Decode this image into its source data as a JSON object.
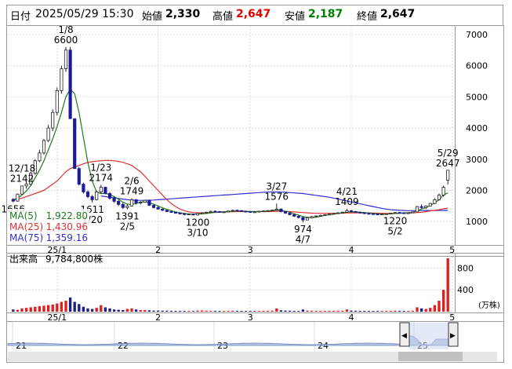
{
  "header": {
    "date_label": "日付",
    "datetime": "2025/05/29 15:30",
    "open_label": "始値",
    "open_value": "2,330",
    "high_label": "高値",
    "high_value": "2,647",
    "low_label": "安値",
    "low_value": "2,187",
    "close_label": "終値",
    "close_value": "2,647"
  },
  "colors": {
    "up": "#ffffff",
    "down": "#1a1aa0",
    "ma5": "#1e7a1e",
    "ma25": "#e03030",
    "ma75": "#3030d0",
    "high_value": "#e00000",
    "low_value": "#008000",
    "volume_up": "#e02020",
    "volume_down": "#202080",
    "minimap": "#8aa0d0"
  },
  "legend": [
    {
      "name": "MA(5)",
      "value": "1,922.80",
      "color": "#1e7a1e"
    },
    {
      "name": "MA(25)",
      "value": "1,430.96",
      "color": "#e03030"
    },
    {
      "name": "MA(75)",
      "value": "1,359.16",
      "color": "#3030d0"
    }
  ],
  "volume_panel": {
    "label": "出来高",
    "value": "9,784,800株",
    "unit": "(万株)"
  },
  "minimap": {
    "year_labels": [
      "21",
      "22",
      "23",
      "24",
      "25"
    ],
    "left_handle": "◀",
    "right_handle": "▶"
  },
  "chart_data": {
    "type": "candlestick",
    "y_ticks": [
      1000,
      2000,
      3000,
      4000,
      5000,
      6000,
      7000
    ],
    "ylim": [
      300,
      7200
    ],
    "x_tick_labels": [
      "25/1",
      "2",
      "3",
      "4",
      "5"
    ],
    "x_tick_index": [
      10,
      33,
      54,
      77,
      100
    ],
    "candles": [
      [
        1710,
        1750,
        1620,
        1656
      ],
      [
        1656,
        1900,
        1640,
        1880
      ],
      [
        1880,
        2150,
        1860,
        2142
      ],
      [
        2142,
        2300,
        2050,
        2200
      ],
      [
        2200,
        2600,
        2150,
        2550
      ],
      [
        2550,
        3000,
        2500,
        2950
      ],
      [
        2950,
        3300,
        2900,
        3200
      ],
      [
        3200,
        3650,
        3150,
        3600
      ],
      [
        3600,
        4100,
        3550,
        4000
      ],
      [
        4000,
        4600,
        3900,
        4500
      ],
      [
        4500,
        5300,
        4400,
        5200
      ],
      [
        5200,
        6000,
        5100,
        5900
      ],
      [
        5900,
        6600,
        5800,
        6500
      ],
      [
        6500,
        6600,
        4300,
        4300
      ],
      [
        4300,
        4300,
        2700,
        2700
      ],
      [
        2700,
        2750,
        2150,
        2200
      ],
      [
        2200,
        2250,
        1900,
        1950
      ],
      [
        1950,
        2000,
        1750,
        1800
      ],
      [
        1800,
        1850,
        1611,
        1700
      ],
      [
        1700,
        2000,
        1680,
        1950
      ],
      [
        1950,
        2174,
        1900,
        2100
      ],
      [
        2100,
        2120,
        1880,
        1900
      ],
      [
        1900,
        1950,
        1700,
        1750
      ],
      [
        1750,
        1800,
        1600,
        1650
      ],
      [
        1650,
        1700,
        1500,
        1550
      ],
      [
        1550,
        1600,
        1400,
        1450
      ],
      [
        1450,
        1550,
        1391,
        1500
      ],
      [
        1500,
        1749,
        1480,
        1700
      ],
      [
        1700,
        1720,
        1550,
        1600
      ],
      [
        1600,
        1650,
        1550,
        1620
      ],
      [
        1620,
        1700,
        1600,
        1680
      ],
      [
        1680,
        1700,
        1500,
        1520
      ],
      [
        1520,
        1550,
        1420,
        1450
      ],
      [
        1450,
        1500,
        1380,
        1400
      ],
      [
        1400,
        1420,
        1340,
        1360
      ],
      [
        1360,
        1380,
        1300,
        1320
      ],
      [
        1320,
        1350,
        1280,
        1300
      ],
      [
        1300,
        1320,
        1250,
        1270
      ],
      [
        1270,
        1300,
        1230,
        1250
      ],
      [
        1250,
        1280,
        1200,
        1230
      ],
      [
        1230,
        1260,
        1210,
        1240
      ],
      [
        1240,
        1250,
        1200,
        1210
      ],
      [
        1210,
        1280,
        1200,
        1260
      ],
      [
        1260,
        1300,
        1240,
        1280
      ],
      [
        1280,
        1320,
        1260,
        1300
      ],
      [
        1300,
        1350,
        1280,
        1330
      ],
      [
        1330,
        1360,
        1300,
        1320
      ],
      [
        1320,
        1340,
        1290,
        1300
      ],
      [
        1300,
        1330,
        1280,
        1310
      ],
      [
        1310,
        1350,
        1300,
        1340
      ],
      [
        1340,
        1380,
        1320,
        1360
      ],
      [
        1360,
        1390,
        1340,
        1350
      ],
      [
        1350,
        1370,
        1320,
        1330
      ],
      [
        1330,
        1350,
        1310,
        1320
      ],
      [
        1320,
        1340,
        1290,
        1300
      ],
      [
        1300,
        1330,
        1280,
        1310
      ],
      [
        1310,
        1340,
        1300,
        1330
      ],
      [
        1330,
        1360,
        1310,
        1340
      ],
      [
        1340,
        1370,
        1320,
        1350
      ],
      [
        1350,
        1380,
        1330,
        1370
      ],
      [
        1370,
        1576,
        1360,
        1400
      ],
      [
        1400,
        1420,
        1300,
        1320
      ],
      [
        1320,
        1340,
        1250,
        1270
      ],
      [
        1270,
        1290,
        1200,
        1220
      ],
      [
        1220,
        1250,
        1150,
        1170
      ],
      [
        1170,
        1200,
        1100,
        1130
      ],
      [
        1130,
        1150,
        974,
        1050
      ],
      [
        1050,
        1150,
        1040,
        1120
      ],
      [
        1120,
        1180,
        1100,
        1160
      ],
      [
        1160,
        1200,
        1140,
        1180
      ],
      [
        1180,
        1220,
        1160,
        1200
      ],
      [
        1200,
        1240,
        1180,
        1220
      ],
      [
        1220,
        1260,
        1200,
        1240
      ],
      [
        1240,
        1280,
        1220,
        1260
      ],
      [
        1260,
        1300,
        1240,
        1280
      ],
      [
        1280,
        1320,
        1260,
        1300
      ],
      [
        1300,
        1409,
        1290,
        1350
      ],
      [
        1350,
        1370,
        1300,
        1320
      ],
      [
        1320,
        1340,
        1280,
        1300
      ],
      [
        1300,
        1320,
        1260,
        1280
      ],
      [
        1280,
        1300,
        1240,
        1260
      ],
      [
        1260,
        1280,
        1230,
        1250
      ],
      [
        1250,
        1270,
        1220,
        1240
      ],
      [
        1240,
        1260,
        1220,
        1230
      ],
      [
        1230,
        1250,
        1220,
        1240
      ],
      [
        1240,
        1260,
        1230,
        1250
      ],
      [
        1250,
        1280,
        1240,
        1270
      ],
      [
        1270,
        1300,
        1250,
        1290
      ],
      [
        1290,
        1310,
        1260,
        1280
      ],
      [
        1280,
        1300,
        1250,
        1270
      ],
      [
        1270,
        1290,
        1250,
        1280
      ],
      [
        1280,
        1320,
        1270,
        1310
      ],
      [
        1310,
        1500,
        1300,
        1480
      ],
      [
        1480,
        1550,
        1420,
        1450
      ],
      [
        1450,
        1520,
        1400,
        1500
      ],
      [
        1500,
        1600,
        1480,
        1580
      ],
      [
        1580,
        1750,
        1560,
        1700
      ],
      [
        1700,
        1900,
        1680,
        1850
      ],
      [
        1850,
        2150,
        1800,
        2100
      ],
      [
        2330,
        2647,
        2187,
        2647
      ]
    ],
    "ma5": [
      1700,
      1750,
      1850,
      1980,
      2150,
      2400,
      2650,
      2950,
      3300,
      3650,
      4050,
      4500,
      5000,
      5250,
      5100,
      4500,
      3700,
      2900,
      2300,
      1950,
      1900,
      1900,
      1870,
      1800,
      1720,
      1620,
      1560,
      1550,
      1580,
      1620,
      1640,
      1610,
      1560,
      1500,
      1440,
      1390,
      1350,
      1310,
      1280,
      1260,
      1240,
      1240,
      1240,
      1250,
      1260,
      1280,
      1300,
      1310,
      1310,
      1320,
      1330,
      1340,
      1340,
      1330,
      1320,
      1320,
      1320,
      1330,
      1340,
      1350,
      1370,
      1360,
      1330,
      1300,
      1250,
      1210,
      1160,
      1130,
      1130,
      1140,
      1170,
      1200,
      1220,
      1240,
      1260,
      1280,
      1300,
      1310,
      1310,
      1300,
      1290,
      1270,
      1260,
      1250,
      1240,
      1240,
      1250,
      1260,
      1270,
      1280,
      1285,
      1300,
      1350,
      1400,
      1450,
      1520,
      1600,
      1700,
      1850,
      1922.8
    ],
    "ma25": [
      1700,
      1720,
      1750,
      1800,
      1850,
      1900,
      1950,
      2000,
      2100,
      2200,
      2300,
      2450,
      2600,
      2700,
      2750,
      2800,
      2850,
      2900,
      2920,
      2940,
      2950,
      2960,
      2960,
      2950,
      2930,
      2900,
      2850,
      2800,
      2700,
      2600,
      2450,
      2300,
      2150,
      2000,
      1850,
      1700,
      1580,
      1480,
      1400,
      1350,
      1310,
      1290,
      1280,
      1280,
      1280,
      1285,
      1290,
      1300,
      1305,
      1310,
      1315,
      1320,
      1320,
      1320,
      1320,
      1320,
      1320,
      1320,
      1320,
      1325,
      1330,
      1335,
      1330,
      1320,
      1310,
      1300,
      1290,
      1280,
      1270,
      1265,
      1265,
      1265,
      1265,
      1265,
      1265,
      1270,
      1275,
      1280,
      1280,
      1280,
      1280,
      1280,
      1275,
      1270,
      1265,
      1260,
      1260,
      1260,
      1265,
      1270,
      1275,
      1280,
      1290,
      1300,
      1320,
      1340,
      1360,
      1380,
      1410,
      1430.96
    ],
    "ma75": [
      null,
      null,
      null,
      null,
      null,
      null,
      null,
      null,
      null,
      null,
      null,
      null,
      null,
      null,
      null,
      null,
      null,
      null,
      null,
      null,
      1820,
      1800,
      1780,
      1760,
      1740,
      1720,
      1700,
      1690,
      1680,
      1680,
      1680,
      1685,
      1690,
      1700,
      1710,
      1720,
      1730,
      1740,
      1750,
      1760,
      1770,
      1780,
      1790,
      1800,
      1810,
      1820,
      1830,
      1840,
      1850,
      1860,
      1870,
      1880,
      1890,
      1900,
      1910,
      1920,
      1930,
      1940,
      1945,
      1950,
      1950,
      1945,
      1940,
      1930,
      1920,
      1910,
      1900,
      1880,
      1860,
      1840,
      1820,
      1800,
      1780,
      1750,
      1720,
      1690,
      1660,
      1630,
      1600,
      1570,
      1540,
      1510,
      1480,
      1450,
      1420,
      1400,
      1380,
      1370,
      1360,
      1355,
      1350,
      1350,
      1350,
      1352,
      1354,
      1355,
      1356,
      1357,
      1358,
      1359.16
    ],
    "volume": [
      40,
      35,
      60,
      70,
      80,
      90,
      100,
      110,
      120,
      130,
      150,
      180,
      200,
      260,
      180,
      140,
      90,
      60,
      50,
      70,
      120,
      80,
      60,
      40,
      35,
      30,
      50,
      60,
      40,
      30,
      30,
      25,
      20,
      20,
      18,
      18,
      16,
      15,
      15,
      14,
      14,
      13,
      20,
      22,
      18,
      16,
      15,
      14,
      14,
      16,
      18,
      16,
      15,
      14,
      13,
      14,
      15,
      16,
      17,
      18,
      60,
      25,
      20,
      18,
      15,
      14,
      40,
      20,
      18,
      16,
      15,
      15,
      16,
      17,
      18,
      18,
      40,
      20,
      18,
      16,
      15,
      14,
      14,
      14,
      15,
      15,
      16,
      18,
      16,
      15,
      15,
      18,
      80,
      60,
      50,
      70,
      120,
      200,
      400,
      978
    ],
    "annotations": [
      {
        "i": 12,
        "text1": "1/8",
        "text2": "6600",
        "pos": "above"
      },
      {
        "i": 2,
        "text1": "12/18",
        "text2": "2142",
        "pos": "above"
      },
      {
        "i": 0,
        "text1": "1656",
        "text2": "",
        "pos": "below-label"
      },
      {
        "i": 20,
        "text1": "1/23",
        "text2": "2174",
        "pos": "above"
      },
      {
        "i": 18,
        "text1": "1611",
        "text2": "1/20",
        "pos": "below"
      },
      {
        "i": 27,
        "text1": "2/6",
        "text2": "1749",
        "pos": "above"
      },
      {
        "i": 26,
        "text1": "1391",
        "text2": "2/5",
        "pos": "below"
      },
      {
        "i": 60,
        "text1": "3/27",
        "text2": "1576",
        "pos": "above"
      },
      {
        "i": 42,
        "text1": "1200",
        "text2": "3/10",
        "pos": "below"
      },
      {
        "i": 66,
        "text1": "974",
        "text2": "4/7",
        "pos": "below"
      },
      {
        "i": 76,
        "text1": "4/21",
        "text2": "1409",
        "pos": "above"
      },
      {
        "i": 87,
        "text1": "1220",
        "text2": "5/2",
        "pos": "below"
      },
      {
        "i": 99,
        "text1": "5/29",
        "text2": "2647",
        "pos": "above"
      }
    ],
    "volume_ticks": [
      400,
      800
    ],
    "volume_ylim": [
      0,
      1050
    ]
  }
}
